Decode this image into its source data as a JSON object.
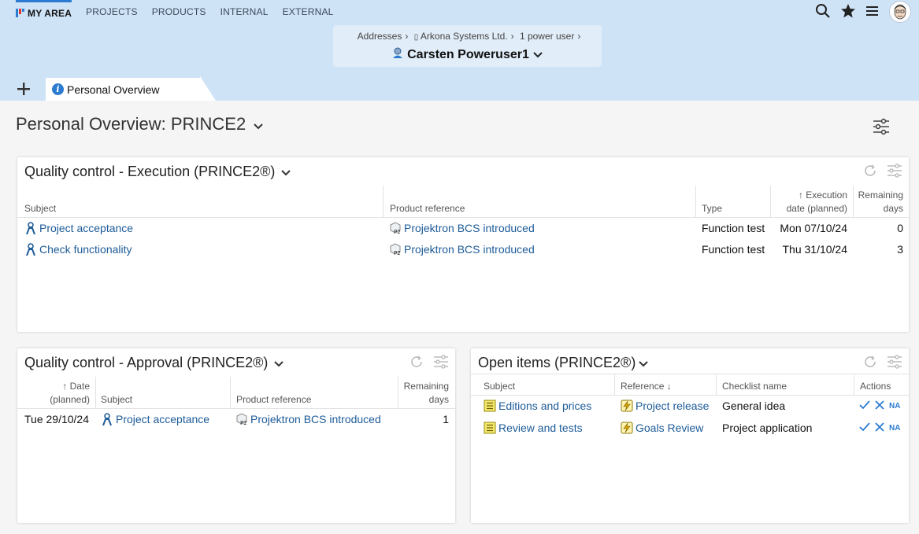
{
  "nav": {
    "items": [
      "MY AREA",
      "PROJECTS",
      "PRODUCTS",
      "INTERNAL",
      "EXTERNAL"
    ]
  },
  "header": {
    "breadcrumb": [
      "Addresses",
      "Arkona Systems Ltd.",
      "1 power user"
    ],
    "person": "Carsten Poweruser1"
  },
  "tabs": {
    "active": "Personal Overview"
  },
  "page": {
    "title": "Personal Overview: PRINCE2"
  },
  "panel_execution": {
    "title": "Quality control - Execution (PRINCE2®)",
    "columns": [
      "Subject",
      "Product reference",
      "Type",
      "Execution",
      "date (planned)",
      "Remaining",
      "days"
    ],
    "rows": [
      {
        "subject": "Project acceptance",
        "product": "Projektron BCS introduced",
        "type": "Function test",
        "date": "Mon 07/10/24",
        "days": "0"
      },
      {
        "subject": "Check functionality",
        "product": "Projektron BCS introduced",
        "type": "Function test",
        "date": "Thu 31/10/24",
        "days": "3"
      }
    ]
  },
  "panel_approval": {
    "title": "Quality control - Approval (PRINCE2®)",
    "columns": [
      "Date",
      "(planned)",
      "Subject",
      "Product reference",
      "Remaining",
      "days"
    ],
    "rows": [
      {
        "date": "Tue 29/10/24",
        "subject": "Project acceptance",
        "product": "Projektron BCS introduced",
        "days": "1"
      }
    ]
  },
  "panel_open": {
    "title": "Open items (PRINCE2®)",
    "columns": [
      "Subject",
      "Reference",
      "Checklist name",
      "Actions"
    ],
    "rows": [
      {
        "subject": "Editions and prices",
        "reference": "Project release",
        "checklist": "General idea",
        "na": "NA"
      },
      {
        "subject": "Review and tests",
        "reference": "Goals Review",
        "checklist": "Project application",
        "na": "NA"
      }
    ]
  },
  "colors": {
    "header_bg": "#cfe3f7",
    "link": "#1d5b98",
    "accent": "#2b7bd0"
  }
}
